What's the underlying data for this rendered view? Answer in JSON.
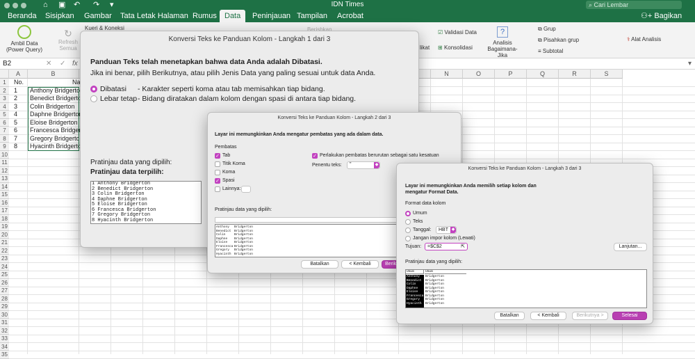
{
  "app": {
    "title": "IDN Times",
    "search_placeholder": "Cari Lembar",
    "share_label": "Bagikan"
  },
  "tabs": [
    "Beranda",
    "Sisipkan",
    "Gambar",
    "Tata Letak Halaman",
    "Rumus",
    "Data",
    "Peninjauan",
    "Tampilan",
    "Acrobat"
  ],
  "ribbon": {
    "get_data": "Ambil Data (Power Query)",
    "refresh_all": "Refresh Semua",
    "queries": "Kueri & Koneksi",
    "filter_adv": "Berishkan",
    "flash_fill": "likat",
    "data_validation": "Validasi Data",
    "consolidate": "Konsolidasi",
    "what_if": "Analisis Bagaimana-Jika",
    "group": "Grup",
    "ungroup": "Pisahkan grup",
    "subtotal": "Subtotal",
    "analysis_tools": "Alat Analisis"
  },
  "formula_bar": {
    "name_box": "B2",
    "fx": "fx"
  },
  "sheet": {
    "columns": [
      "A",
      "B",
      "C",
      "D",
      "E",
      "F",
      "G",
      "H",
      "I",
      "J",
      "K",
      "L",
      "M",
      "N",
      "O",
      "P",
      "Q",
      "R",
      "S"
    ],
    "header_row": {
      "a": "No.",
      "b": "Na"
    },
    "rows": [
      {
        "no": "1",
        "name": "Anthony Bridgerton"
      },
      {
        "no": "2",
        "name": "Benedict Bridgerton"
      },
      {
        "no": "3",
        "name": "Colin Bridgerton"
      },
      {
        "no": "4",
        "name": "Daphne Bridgerton"
      },
      {
        "no": "5",
        "name": "Eloise Bridgerton"
      },
      {
        "no": "6",
        "name": "Francesca Bridgerton"
      },
      {
        "no": "7",
        "name": "Gregory Bridgerton"
      },
      {
        "no": "8",
        "name": "Hyacinth Bridgerton"
      }
    ]
  },
  "step1": {
    "title": "Konversi Teks ke Panduan Kolom - Langkah 1 dari 3",
    "intro": "Panduan Teks telah menetapkan bahwa data Anda adalah Dibatasi.",
    "instruction": "Jika ini benar, pilih Berikutnya, atau pilih Jenis Data yang paling sesuai untuk data Anda.",
    "opt_delimited": "Dibatasi",
    "opt_delimited_desc": "- Karakter seperti koma atau tab memisahkan tiap bidang.",
    "opt_fixed": "Lebar tetap",
    "opt_fixed_desc": "- Bidang diratakan dalam kolom dengan spasi di antara tiap bidang.",
    "preview_label": "Pratinjau data yang dipilih:",
    "preview_heading": "Pratinjau data terpilih:",
    "preview_lines": [
      "1 Anthony Bridgerton",
      "2 Benedict Bridgerton",
      "3 Colin Bridgerton",
      "4 Daphne Bridgerton",
      "5 Eloise Bridgerton",
      "6 Francesca Bridgerton",
      "7 Gregory Bridgerton",
      "8 Hyacinth Bridgerton"
    ]
  },
  "step2": {
    "title": "Konversi Teks ke Panduan Kolom - Langkah 2 dari 3",
    "intro": "Layar ini memungkinkan Anda mengatur pembatas yang ada dalam data.",
    "delimiters_label": "Pembatas",
    "tab": "Tab",
    "semicolon": "Titik Koma",
    "comma": "Koma",
    "space": "Spasi",
    "other": "Lainnya:",
    "treat_consecutive": "Perlakukan pembatas berurutan sebagai satu kesatuan",
    "text_qualifier_label": "Penentu teks:",
    "text_qualifier_value": "\"",
    "preview_label": "Pratinjau data yang dipilih:",
    "preview_col1": [
      "Anthony",
      "Benedict",
      "Colin",
      "Daphne",
      "Eloise",
      "Francesca",
      "Gregory",
      "Hyacinth"
    ],
    "preview_col2": [
      "Bridgerton",
      "Bridgerton",
      "Bridgerton",
      "Bridgerton",
      "Bridgerton",
      "Bridgerton",
      "Bridgerton",
      "Bridgerton"
    ],
    "cancel": "Batalkan",
    "back": "< Kembali",
    "next": "Beriku"
  },
  "step3": {
    "title": "Konversi Teks ke Panduan Kolom - Langkah 3 dari 3",
    "intro": "Layar ini memungkinkan Anda memilih setiap kolom dan mengatur Format Data.",
    "format_label": "Format data kolom",
    "general": "Umum",
    "text": "Teks",
    "date": "Tanggal:",
    "date_value": "HBT",
    "skip": "Jangan impor kolom (Lewati)",
    "destination_label": "Tujuan:",
    "destination_value": "=$C$2",
    "advanced": "Lanjutan...",
    "preview_label": "Pratinjau data yang dipilih:",
    "preview_head1": "Umum",
    "preview_head2": "Umum",
    "preview_col1": [
      "Anthony",
      "Benedict",
      "Colin",
      "Daphne",
      "Eloise",
      "Francesca",
      "Gregory",
      "Hyacinth"
    ],
    "preview_col2": [
      "Bridgerton",
      "Bridgerton",
      "Bridgerton",
      "Bridgerton",
      "Bridgerton",
      "Bridgerton",
      "Bridgerton",
      "Bridgerton"
    ],
    "cancel": "Batalkan",
    "back": "< Kembali",
    "next": "Berikutnya >",
    "finish": "Selesai"
  }
}
